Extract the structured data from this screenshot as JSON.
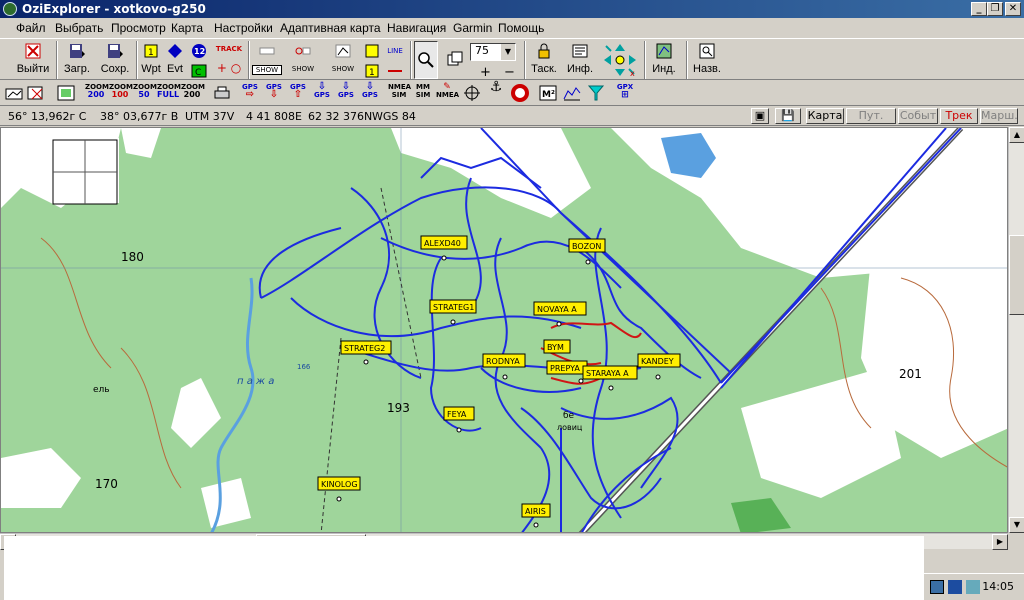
{
  "window": {
    "title": "OziExplorer - xotkovo-g250"
  },
  "menu": [
    "Файл",
    "Выбрать",
    "Просмотр",
    "Карта",
    "Настройки",
    "Адаптивная карта",
    "Навигация",
    "Garmin",
    "Помощь"
  ],
  "toolbar": {
    "exit": "Выйти",
    "load": "Загр.",
    "save": "Сохр.",
    "wpt": "Wpt",
    "evt": "Evt",
    "track": "TRACK",
    "show": "SHOW",
    "zoom_value": "75",
    "task": "Таск.",
    "info": "Инф.",
    "ind": "Инд.",
    "names": "Назв.",
    "line": "LINE",
    "wpt_num": "12"
  },
  "toolbar2": {
    "zoom_buttons": [
      {
        "top": "ZOOM",
        "bottom": "200"
      },
      {
        "top": "ZOOM",
        "bottom": "100"
      },
      {
        "top": "ZOOM",
        "bottom": "50"
      },
      {
        "top": "ZOOM",
        "bottom": "FULL"
      },
      {
        "top": "ZOOM",
        "bottom": "200"
      }
    ],
    "gps": "GPS",
    "nmea_sim": "NMEA SIM",
    "mm_sim": "MM SIM",
    "nmea": "NMEA",
    "gpx": "GPX"
  },
  "status": {
    "lat": "56° 13,962г С",
    "lon": "38° 03,677г В",
    "utm_zone": "UTM  37V",
    "easting": "4 41 808E",
    "northing": "62 32 376N",
    "datum": "WGS 84"
  },
  "modes": [
    {
      "label": "Карта",
      "active": true,
      "color": "#000000"
    },
    {
      "label": "Пут. точ.",
      "active": false,
      "color": "#808080"
    },
    {
      "label": "Событ",
      "active": false,
      "color": "#808080"
    },
    {
      "label": "Трек",
      "active": true,
      "color": "#cc0000"
    },
    {
      "label": "Марш.",
      "active": false,
      "color": "#808080"
    }
  ],
  "map": {
    "waypoints": [
      "ALEXD40",
      "BOZON",
      "STRATEG1",
      "NOVAYA A",
      "STRATEG2",
      "RODNYA",
      "BYM",
      "KANDEY",
      "PREPYA",
      "STARAYA A",
      "FEYA",
      "KINOLOG",
      "AIRIS"
    ],
    "elevations": [
      "180",
      "193",
      "201",
      "170"
    ],
    "place_labels": [
      "ель",
      "п а ж а",
      "166",
      "бе",
      "ловиц"
    ],
    "colors": {
      "forest": "#9fd59b",
      "clearing": "#ffffff",
      "water": "#5aa0e0",
      "track": "#1c2be0",
      "route": "#d01515"
    }
  },
  "tray": {
    "clock": "14:05"
  }
}
